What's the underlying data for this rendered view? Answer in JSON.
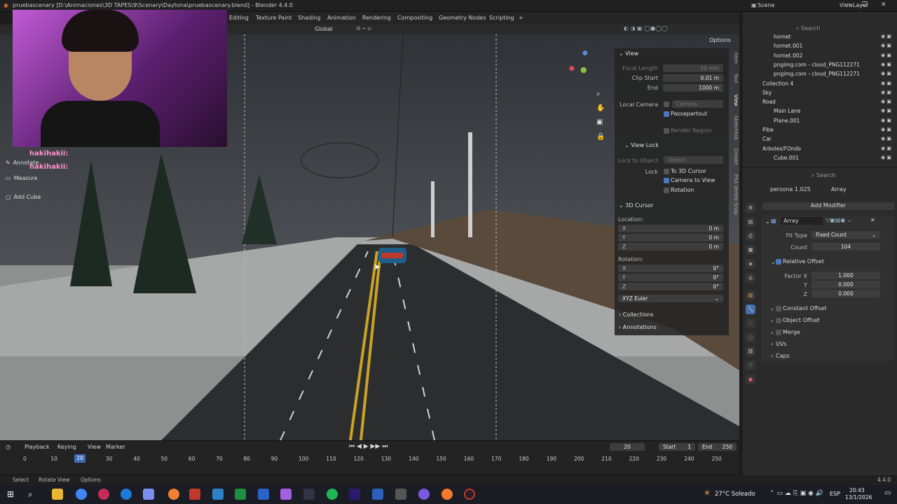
{
  "window": {
    "title": "pruebascenary [D:\\Animaciones\\3D TAPES\\9\\Scenary\\Daytona\\pruebascenary.blend] - Blender 4.4.0",
    "scene": "Scene",
    "view_layer": "ViewLayer"
  },
  "workspaces": [
    "Editing",
    "Texture Paint",
    "Shading",
    "Animation",
    "Rendering",
    "Compositing",
    "Geometry Nodes",
    "Scripting"
  ],
  "header": {
    "transform_orientation": "Global",
    "options_label": "Options"
  },
  "left_tools": {
    "annotate": "Annotate",
    "measure": "Measure",
    "add_cube": "Add Cube"
  },
  "chat": [
    {
      "user": "hakihakii:"
    },
    {
      "user": "hakihakii:"
    }
  ],
  "npanel": {
    "tabs": [
      "Item",
      "Tool",
      "View",
      "Sketchfab",
      "Create",
      "PSX Vertex Snap"
    ],
    "view_title": "View",
    "focal_length_label": "Focal Length",
    "focal_length": "50 mm",
    "clip_start_label": "Clip Start",
    "clip_start": "0.01 m",
    "end_label": "End",
    "end": "1000 m",
    "local_camera_label": "Local Camera",
    "camera_field": "Camera",
    "passepartout": "Passepartout",
    "render_region": "Render Region",
    "view_lock_title": "View Lock",
    "lock_to_object_label": "Lock to Object",
    "object_field": "Object",
    "lock_label": "Lock",
    "to_3d_cursor": "To 3D Cursor",
    "camera_to_view": "Camera to View",
    "rotation_chk": "Rotation",
    "cursor_title": "3D Cursor",
    "location_label": "Location:",
    "loc_x": "0 m",
    "loc_y": "0 m",
    "loc_z": "0 m",
    "rotation_label": "Rotation:",
    "rot_x": "0°",
    "rot_y": "0°",
    "rot_z": "0°",
    "euler": "XYZ Euler",
    "collections": "Collections",
    "annotations": "Annotations"
  },
  "outliner": [
    {
      "name": "hornet",
      "indent": 3
    },
    {
      "name": "hornet.001",
      "indent": 3
    },
    {
      "name": "hornet.002",
      "indent": 3
    },
    {
      "name": "pngimg.com - cloud_PNG112271",
      "indent": 3
    },
    {
      "name": "pngimg.com - cloud_PNG112271",
      "indent": 3
    },
    {
      "name": "Collection 4",
      "indent": 1
    },
    {
      "name": "Sky",
      "indent": 1
    },
    {
      "name": "Road",
      "indent": 1
    },
    {
      "name": "Main Lane",
      "indent": 3
    },
    {
      "name": "Plane.001",
      "indent": 3
    },
    {
      "name": "Pibe",
      "indent": 1
    },
    {
      "name": "Car",
      "indent": 1
    },
    {
      "name": "Arboles/FOndo",
      "indent": 1
    },
    {
      "name": "Cube.001",
      "indent": 3
    }
  ],
  "properties": {
    "object_name": "persona 1.025",
    "modifier_crumb": "Array",
    "add_modifier": "Add Modifier",
    "modifier_name": "Array",
    "fit_type_label": "Fit Type",
    "fit_type": "Fixed Count",
    "count_label": "Count",
    "count": "104",
    "relative_offset": "Relative Offset",
    "factor_x_label": "Factor X",
    "factor_x": "1.000",
    "y_label": "Y",
    "factor_y": "0.000",
    "z_label": "Z",
    "factor_z": "0.000",
    "constant_offset": "Constant Offset",
    "object_offset": "Object Offset",
    "merge": "Merge",
    "uvs": "UVs",
    "caps": "Caps"
  },
  "timeline": {
    "playback": "Playback",
    "keying": "Keying",
    "view": "View",
    "marker": "Marker",
    "current_frame": "20",
    "start_label": "Start",
    "start": "1",
    "end_label": "End",
    "end": "250",
    "ticks": [
      "0",
      "10",
      "20",
      "30",
      "40",
      "50",
      "60",
      "70",
      "80",
      "90",
      "100",
      "110",
      "120",
      "130",
      "140",
      "150",
      "160",
      "170",
      "180",
      "190",
      "200",
      "210",
      "220",
      "230",
      "240",
      "250"
    ]
  },
  "statusbar": {
    "select": "Select",
    "rotate_view": "Rotate View",
    "options": "Options",
    "version": "4.4.0"
  },
  "taskbar": {
    "weather": "27°C  Soleado",
    "lang": "ESP",
    "time": "20:43",
    "date": "13/1/2026"
  }
}
